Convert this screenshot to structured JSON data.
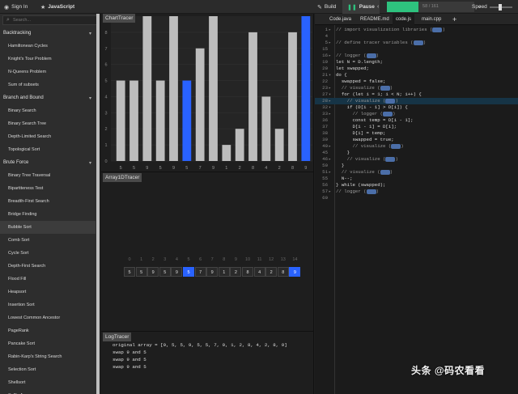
{
  "topbar": {
    "sign_in": "Sign In",
    "sign_in_icon": "github-icon",
    "language": "JavaScript",
    "language_icon": "star-icon",
    "build": "Build",
    "build_icon": "wrench-icon",
    "pause": "Pause",
    "pause_icon": "pause-icon",
    "progress_text": "58 / 161",
    "progress_fraction": 0.36,
    "speed_label": "Speed",
    "speed_fraction": 0.45
  },
  "sidebar": {
    "search_placeholder": "Search...",
    "sections": [
      {
        "label": "Backtracking",
        "items": [
          "Hamiltonean Cycles",
          "Knight's Tour Problem",
          "N-Queens Problem",
          "Sum of subsets"
        ]
      },
      {
        "label": "Branch and Bound",
        "items": [
          "Binary Search",
          "Binary Search Tree",
          "Depth-Limited Search",
          "Topological Sort"
        ]
      },
      {
        "label": "Brute Force",
        "items": [
          "Binary Tree Traversal",
          "Bipartiteness Test",
          "Breadth-First Search",
          "Bridge Finding",
          "Bubble Sort",
          "Comb Sort",
          "Cycle Sort",
          "Depth-First Search",
          "Flood Fill",
          "Heapsort",
          "Insertion Sort",
          "Lowest Common Ancestor",
          "PageRank",
          "Pancake Sort",
          "Rabin-Karp's String Search",
          "Selection Sort",
          "Shellsort",
          "Suffix Array"
        ]
      }
    ],
    "active_item": "Bubble Sort"
  },
  "chart_tracer": {
    "title": "ChartTracer",
    "values": [
      5,
      5,
      9,
      5,
      9,
      5,
      7,
      9,
      1,
      2,
      8,
      4,
      2,
      8,
      9
    ],
    "highlight": [
      5,
      14
    ],
    "ylim": [
      0,
      9
    ],
    "yticks": [
      "0",
      "1",
      "2",
      "3",
      "4",
      "5",
      "6",
      "7",
      "8"
    ],
    "bar_color": "#bdbdbd",
    "highlight_color": "#2962ff"
  },
  "array_tracer": {
    "title": "Array1DTracer",
    "indices": [
      "0",
      "1",
      "2",
      "3",
      "4",
      "5",
      "6",
      "7",
      "8",
      "9",
      "10",
      "11",
      "12",
      "13",
      "14"
    ],
    "values": [
      "5",
      "5",
      "9",
      "5",
      "9",
      "5",
      "7",
      "9",
      "1",
      "2",
      "8",
      "4",
      "2",
      "8",
      "9"
    ],
    "highlight": [
      5,
      14
    ]
  },
  "log_tracer": {
    "title": "LogTracer",
    "lines": [
      "original array = [9, 5, 5, 9, 5, 5, 7, 9, 1, 2, 8, 4, 2, 8, 9]",
      "swap 9 and 5",
      "swap 9 and 5",
      "swap 9 and 5"
    ]
  },
  "editor": {
    "tabs": [
      "Code.java",
      "README.md",
      "code.js",
      "main.cpp"
    ],
    "active_tab": "code.js",
    "add_tab_label": "+",
    "highlight_line": "28",
    "lines": [
      {
        "n": "1",
        "fold": "▸",
        "text": "// import visualization libraries",
        "badge": true,
        "kind": "comment"
      },
      {
        "n": "4",
        "fold": "",
        "text": "",
        "badge": false,
        "kind": ""
      },
      {
        "n": "5",
        "fold": "▸",
        "text": "// define tracer variables",
        "badge": true,
        "kind": "comment"
      },
      {
        "n": "15",
        "fold": "",
        "text": "",
        "badge": false,
        "kind": ""
      },
      {
        "n": "16",
        "fold": "▸",
        "text": "// logger",
        "badge": true,
        "kind": "comment"
      },
      {
        "n": "19",
        "fold": "",
        "text": "let N = D.length;",
        "badge": false,
        "kind": ""
      },
      {
        "n": "20",
        "fold": "",
        "text": "let swapped;",
        "badge": false,
        "kind": ""
      },
      {
        "n": "21",
        "fold": "▾",
        "text": "do {",
        "badge": false,
        "kind": ""
      },
      {
        "n": "22",
        "fold": "",
        "text": "  swapped = false;",
        "badge": false,
        "kind": ""
      },
      {
        "n": "23",
        "fold": "▸",
        "text": "  // visualize",
        "badge": true,
        "kind": "comment"
      },
      {
        "n": "27",
        "fold": "▾",
        "text": "  for (let i = 1; i < N; i++) {",
        "badge": false,
        "kind": ""
      },
      {
        "n": "28",
        "fold": "▸",
        "text": "    // visualize",
        "badge": true,
        "kind": "comment"
      },
      {
        "n": "32",
        "fold": "▾",
        "text": "    if (D[i - 1] > D[i]) {",
        "badge": false,
        "kind": ""
      },
      {
        "n": "33",
        "fold": "▸",
        "text": "      // logger",
        "badge": true,
        "kind": "comment"
      },
      {
        "n": "36",
        "fold": "",
        "text": "      const temp = D[i - 1];",
        "badge": false,
        "kind": ""
      },
      {
        "n": "37",
        "fold": "",
        "text": "      D[i - 1] = D[i];",
        "badge": false,
        "kind": ""
      },
      {
        "n": "38",
        "fold": "",
        "text": "      D[i] = temp;",
        "badge": false,
        "kind": ""
      },
      {
        "n": "39",
        "fold": "",
        "text": "      swapped = true;",
        "badge": false,
        "kind": ""
      },
      {
        "n": "40",
        "fold": "▸",
        "text": "      // visualize",
        "badge": true,
        "kind": "comment"
      },
      {
        "n": "45",
        "fold": "",
        "text": "    }",
        "badge": false,
        "kind": ""
      },
      {
        "n": "46",
        "fold": "▸",
        "text": "    // visualize",
        "badge": true,
        "kind": "comment"
      },
      {
        "n": "50",
        "fold": "",
        "text": "  }",
        "badge": false,
        "kind": ""
      },
      {
        "n": "51",
        "fold": "▸",
        "text": "  // visualize",
        "badge": true,
        "kind": "comment"
      },
      {
        "n": "55",
        "fold": "",
        "text": "  N--;",
        "badge": false,
        "kind": ""
      },
      {
        "n": "56",
        "fold": "",
        "text": "} while (swapped);",
        "badge": false,
        "kind": ""
      },
      {
        "n": "57",
        "fold": "▸",
        "text": "// logger",
        "badge": true,
        "kind": "comment"
      },
      {
        "n": "60",
        "fold": "",
        "text": "",
        "badge": false,
        "kind": ""
      }
    ]
  },
  "watermark": {
    "text": "头条 @码农看看"
  }
}
